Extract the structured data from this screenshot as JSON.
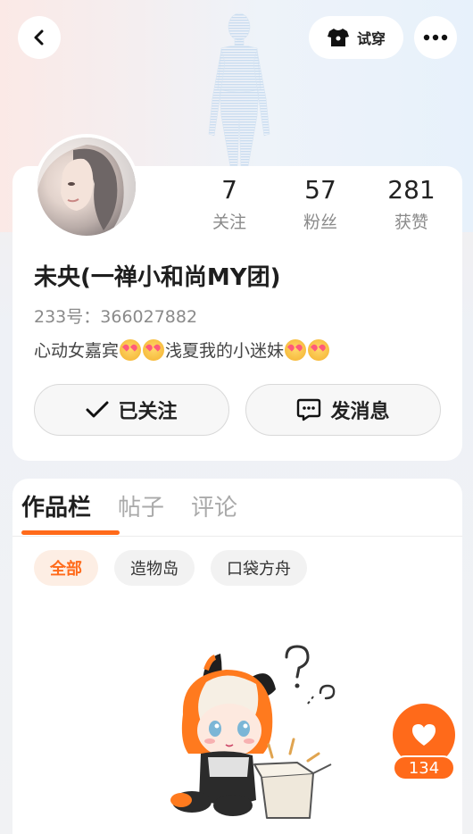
{
  "header": {
    "tryon_label": "试穿"
  },
  "stats": [
    {
      "value": "7",
      "label": "关注"
    },
    {
      "value": "57",
      "label": "粉丝"
    },
    {
      "value": "281",
      "label": "获赞"
    }
  ],
  "profile": {
    "username": "未央(一禅小和尚MY团)",
    "uid": "233号：366027882",
    "bio_parts": [
      "心动女嘉宾",
      "浅夏我的小迷妹"
    ]
  },
  "actions": {
    "follow_label": "已关注",
    "message_label": "发消息"
  },
  "tabs": [
    {
      "label": "作品栏",
      "active": true
    },
    {
      "label": "帖子",
      "active": false
    },
    {
      "label": "评论",
      "active": false
    }
  ],
  "filters": [
    {
      "label": "全部",
      "active": true
    },
    {
      "label": "造物岛",
      "active": false
    },
    {
      "label": "口袋方舟",
      "active": false
    }
  ],
  "like": {
    "count": "134"
  },
  "colors": {
    "accent": "#ff6a1a",
    "accent_bg": "#fdeee4"
  },
  "icons": {
    "back": "chevron-left-icon",
    "tryon": "tshirt-icon",
    "more": "more-dots-icon",
    "follow": "check-icon",
    "message": "chat-bubble-icon",
    "like": "heart-icon"
  }
}
